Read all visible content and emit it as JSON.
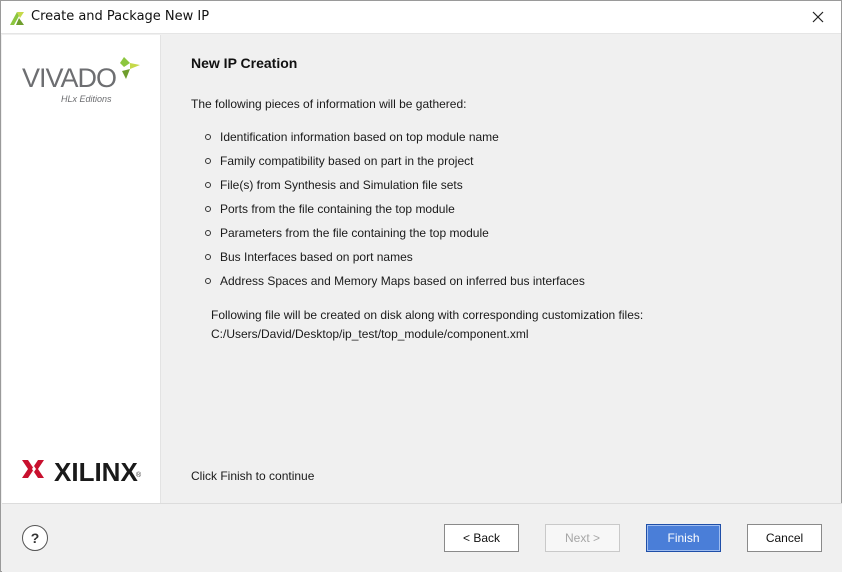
{
  "window": {
    "title": "Create and Package New IP"
  },
  "branding": {
    "vivado": "VIVADO",
    "vivado_sub": "HLx Editions",
    "xilinx": "XILINX",
    "xilinx_reg": "®"
  },
  "content": {
    "title": "New IP Creation",
    "intro": "The following pieces of information will be gathered:",
    "bullets": [
      "Identification information based on top module name",
      "Family compatibility based on part in the project",
      "File(s) from Synthesis and Simulation file sets",
      "Ports from the file containing the top module",
      "Parameters from the file containing the top module",
      "Bus Interfaces based on port names",
      "Address Spaces and Memory Maps based on inferred bus interfaces"
    ],
    "file_note": "Following file will be created on disk along with corresponding customization files:",
    "file_path": "C:/Users/David/Desktop/ip_test/top_module/component.xml",
    "continue_text": "Click Finish to continue"
  },
  "footer": {
    "help_label": "?",
    "back_label": "< Back",
    "next_label": "Next >",
    "finish_label": "Finish",
    "cancel_label": "Cancel",
    "next_enabled": false
  },
  "colors": {
    "finish_button": "#4a7ed8",
    "vivado_leaf": "#8cc63f",
    "xilinx_red": "#c8102e"
  }
}
